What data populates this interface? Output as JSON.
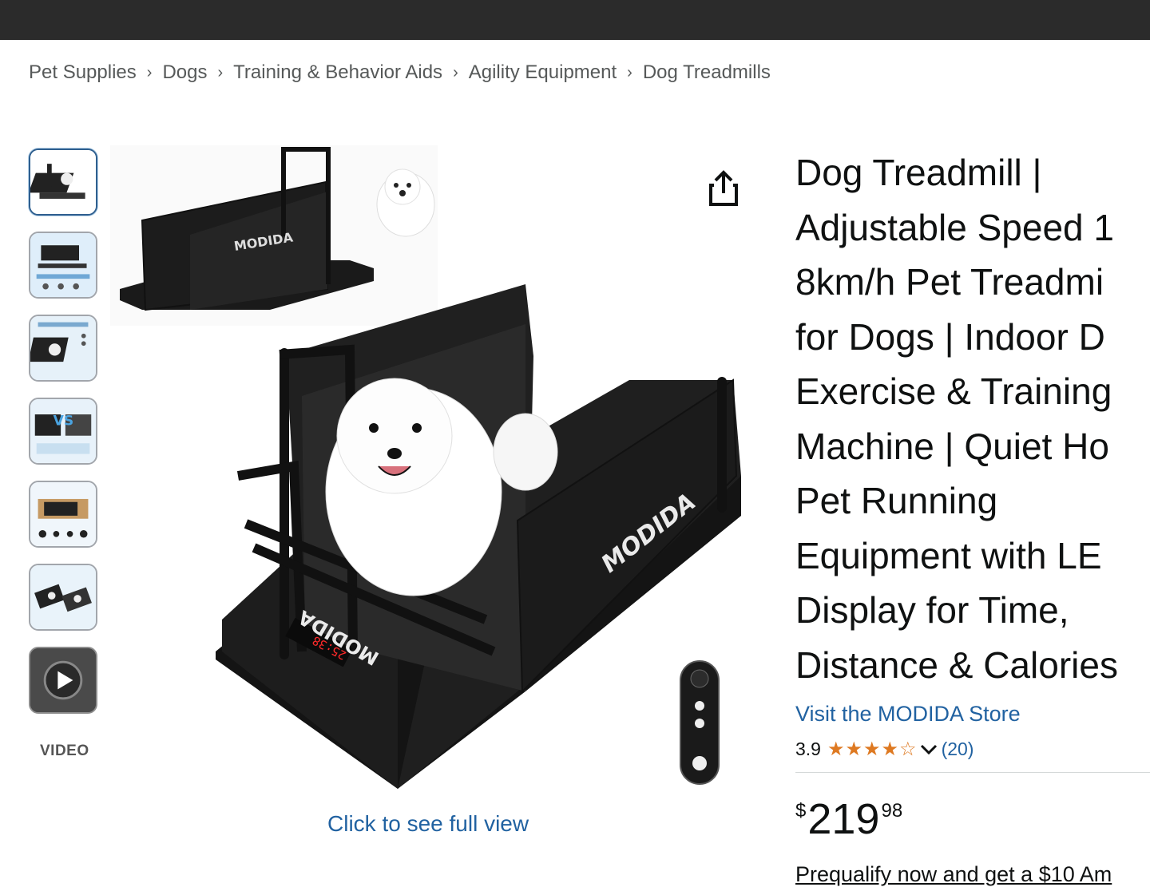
{
  "breadcrumb": [
    "Pet Supplies",
    "Dogs",
    "Training & Behavior Aids",
    "Agility Equipment",
    "Dog Treadmills"
  ],
  "breadcrumb_separator": "›",
  "thumbnails": {
    "count": 7,
    "active_index": 0,
    "video_label": "VIDEO"
  },
  "main_image": {
    "brand_text_top": "MODIDA",
    "brand_text_side": "MODIDA",
    "brand_text_front": "MODIDA",
    "display_readout": "25:38",
    "full_view_link": "Click to see full view"
  },
  "product": {
    "title_lines": [
      "Dog Treadmill |",
      "Adjustable Speed 1",
      "8km/h Pet Treadmi",
      "for Dogs | Indoor D",
      "Exercise & Training",
      "Machine | Quiet Ho",
      "Pet Running",
      "Equipment with LE",
      "Display for Time,",
      "Distance & Calories"
    ],
    "store_link": "Visit the MODIDA Store",
    "rating_value": "3.9",
    "rating_stars": 3.9,
    "review_count": "(20)",
    "price_currency": "$",
    "price_whole": "219",
    "price_fraction": "98",
    "prequalify_link": "Prequalify now and get a $10 Am"
  },
  "colors": {
    "link": "#2162a1",
    "star": "#de7921",
    "topbar": "#2b2b2b",
    "text": "#0f1111"
  }
}
